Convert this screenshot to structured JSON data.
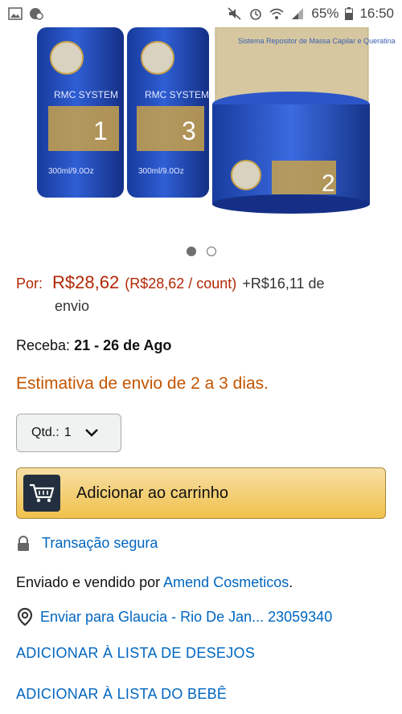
{
  "status_bar": {
    "battery": "65%",
    "time": "16:50"
  },
  "product_image": {
    "bottle_1_step": "1",
    "bottle_2_step": "3",
    "jar_step": "2",
    "brand": "RMC SYSTEM",
    "volume": "300ml/9.0Oz",
    "box_title": "Sistema Repositor de Massa Capilar e Queratina",
    "colors": {
      "bottle": "#1f3fa8",
      "gold": "#c9a24a",
      "box": "#d8c9a3"
    }
  },
  "carousel": {
    "pages": 2,
    "active_index": 0
  },
  "price": {
    "label": "Por:",
    "value": "R$28,62",
    "unit_price": "(R$28,62 / count)",
    "shipping_line1": "+R$16,11 de",
    "shipping_line2": "envio"
  },
  "delivery": {
    "label": "Receba:",
    "dates": "21 - 26 de Ago"
  },
  "estimate": "Estimativa de envio de 2 a 3 dias.",
  "quantity": {
    "label": "Qtd.:",
    "value": "1"
  },
  "cart_button": {
    "label": "Adicionar ao carrinho"
  },
  "secure": {
    "label": "Transação segura"
  },
  "seller": {
    "prefix": "Enviado e vendido por",
    "name": "Amend Cosmeticos",
    "suffix": "."
  },
  "ship_to": {
    "label": "Enviar para Glaucia - Rio De Jan... 23059340"
  },
  "wishlist_link": "ADICIONAR À LISTA DE DESEJOS",
  "babylist_link": "ADICIONAR À LISTA DO BEBÊ"
}
